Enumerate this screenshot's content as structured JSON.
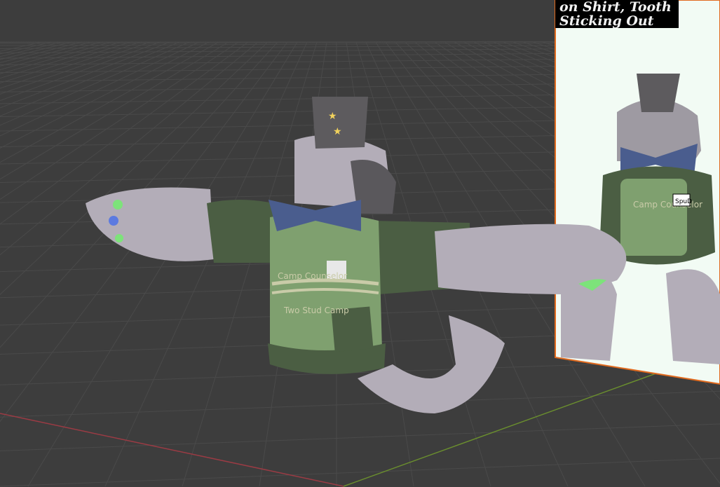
{
  "viewport": {
    "background": "#3d3d3d",
    "grid_color": "#4a4a4a",
    "x_axis_color": "#9b3b44",
    "y_axis_color": "#6a8e2e"
  },
  "reference_image": {
    "caption_lines": [
      "on Shirt, Tooth",
      "Sticking Out"
    ],
    "background": "#f2fbf4",
    "border_color": "#e06a1e",
    "shirt_text": "Camp Counselor",
    "badge_text": "SpuD"
  },
  "model": {
    "shirt_text": "Camp Counselor",
    "shirt_text_2": "Two Stud Camp",
    "shirt_color": "#7fa06f",
    "sleeve_color": "#4b5e43",
    "fur_color": "#b3adb8",
    "bowtie_color": "#4a5d8e",
    "hat_color": "#5d5b5e"
  }
}
